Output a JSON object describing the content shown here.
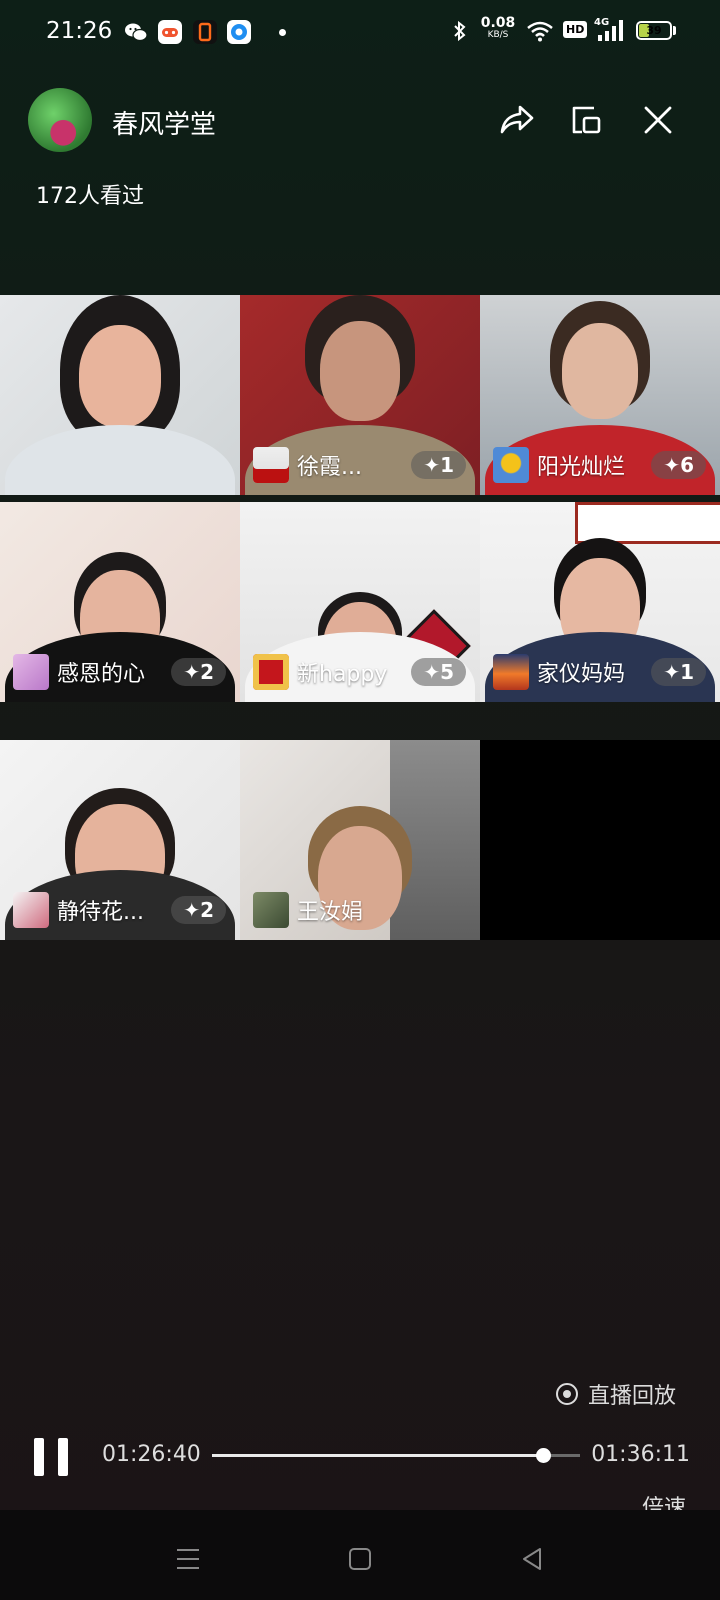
{
  "status_bar": {
    "time": "21:26",
    "net_speed_value": "0.08",
    "net_speed_unit": "KB/S",
    "hd_badge": "HD",
    "network_type": "4G",
    "battery_level": "39",
    "app_icons": [
      "wechat-icon",
      "game-center-icon",
      "orange-app-icon",
      "blue-app-icon"
    ]
  },
  "header": {
    "room_name": "春风学堂",
    "view_count": "172人看过"
  },
  "participants": [
    {
      "name": "",
      "count": "",
      "mini_avatar": false
    },
    {
      "name": "徐霞...",
      "count": "✦1",
      "mini_avatar": true
    },
    {
      "name": "阳光灿烂",
      "count": "✦6",
      "mini_avatar": true
    },
    {
      "name": "感恩的心",
      "count": "✦2",
      "mini_avatar": true
    },
    {
      "name": "新happy",
      "count": "✦5",
      "mini_avatar": true
    },
    {
      "name": "家仪妈妈",
      "count": "✦1",
      "mini_avatar": true
    },
    {
      "name": "静待花...",
      "count": "✦2",
      "mini_avatar": true
    },
    {
      "name": "王汝娟",
      "count": "",
      "mini_avatar": true
    }
  ],
  "playback": {
    "replay_label": "直播回放",
    "current_time": "01:26:40",
    "total_time": "01:36:11",
    "progress_percent": 90,
    "speed_label": "倍速"
  },
  "colors": {
    "background_top": "#0d1f17",
    "background_bottom": "#1b1416",
    "battery_fill": "#b7d34a",
    "nav_bar": "#0c0b0c"
  }
}
